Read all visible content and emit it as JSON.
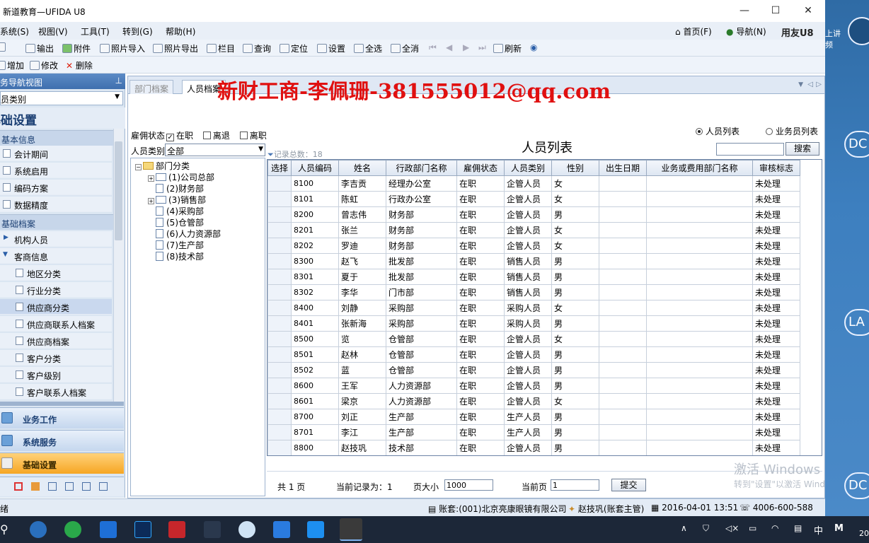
{
  "window": {
    "title": "新道教育—UFIDA U8",
    "minimize": "—",
    "maximize": "☐",
    "close": "✕"
  },
  "menubar": {
    "items": [
      "系统(S)",
      "视图(V)",
      "工具(T)",
      "转到(G)",
      "帮助(H)"
    ],
    "home": "首页(F)",
    "nav": "导航(N)",
    "brand": "用友U8"
  },
  "toolbar": {
    "items": [
      "输出",
      "附件",
      "照片导入",
      "照片导出",
      "栏目",
      "查询",
      "定位",
      "设置",
      "全选",
      "全消",
      "刷新"
    ]
  },
  "toolbar2": {
    "items": [
      "增加",
      "修改",
      "删除"
    ]
  },
  "sidebar": {
    "header": "业务导航视图",
    "select_value": "人员类别",
    "title": "基础设置",
    "group1": "基本信息",
    "group1_items": [
      "会计期间",
      "系统启用",
      "编码方案",
      "数据精度"
    ],
    "group2": "基础档案",
    "sub1": "机构人员",
    "sub2": "客商信息",
    "sub2_items": [
      "地区分类",
      "行业分类",
      "供应商分类",
      "供应商联系人档案",
      "供应商档案",
      "客户分类",
      "客户级别",
      "客户联系人档案"
    ],
    "modules": [
      "业务工作",
      "系统服务",
      "基础设置"
    ]
  },
  "tabs": [
    "部门档案",
    "人员档案"
  ],
  "overlay_text": "新财工商-李佩珊-381555012@qq.com",
  "filters": {
    "employ_label": "雇佣状态",
    "opt_active": "在职",
    "opt_left": "离退",
    "opt_resigned": "离职",
    "category_label": "人员类别",
    "category_value": "全部",
    "record_total": "记录总数：18",
    "list_title": "人员列表",
    "radio_person": "人员列表",
    "radio_sales": "业务员列表",
    "search_btn": "搜索"
  },
  "tree": {
    "root": "部门分类",
    "nodes": [
      "(1)公司总部",
      "(2)财务部",
      "(3)销售部",
      "(4)采购部",
      "(5)仓管部",
      "(6)人力资源部",
      "(7)生产部",
      "(8)技术部"
    ]
  },
  "table": {
    "columns": [
      "选择",
      "人员编码",
      "姓名",
      "行政部门名称",
      "雇佣状态",
      "人员类别",
      "性别",
      "出生日期",
      "业务或费用部门名称",
      "审核标志"
    ],
    "rows": [
      [
        "",
        "8100",
        "李吉贡",
        "经理办公室",
        "在职",
        "企管人员",
        "女",
        "",
        "",
        "未处理"
      ],
      [
        "",
        "8101",
        "陈虹",
        "行政办公室",
        "在职",
        "企管人员",
        "女",
        "",
        "",
        "未处理"
      ],
      [
        "",
        "8200",
        "曾志伟",
        "财务部",
        "在职",
        "企管人员",
        "男",
        "",
        "",
        "未处理"
      ],
      [
        "",
        "8201",
        "张兰",
        "财务部",
        "在职",
        "企管人员",
        "女",
        "",
        "",
        "未处理"
      ],
      [
        "",
        "8202",
        "罗迪",
        "财务部",
        "在职",
        "企管人员",
        "女",
        "",
        "",
        "未处理"
      ],
      [
        "",
        "8300",
        "赵飞",
        "批发部",
        "在职",
        "销售人员",
        "男",
        "",
        "",
        "未处理"
      ],
      [
        "",
        "8301",
        "夏于",
        "批发部",
        "在职",
        "销售人员",
        "男",
        "",
        "",
        "未处理"
      ],
      [
        "",
        "8302",
        "李华",
        "门市部",
        "在职",
        "销售人员",
        "男",
        "",
        "",
        "未处理"
      ],
      [
        "",
        "8400",
        "刘静",
        "采购部",
        "在职",
        "采购人员",
        "女",
        "",
        "",
        "未处理"
      ],
      [
        "",
        "8401",
        "张新海",
        "采购部",
        "在职",
        "采购人员",
        "男",
        "",
        "",
        "未处理"
      ],
      [
        "",
        "8500",
        "览",
        "仓管部",
        "在职",
        "企管人员",
        "女",
        "",
        "",
        "未处理"
      ],
      [
        "",
        "8501",
        "赵林",
        "仓管部",
        "在职",
        "企管人员",
        "男",
        "",
        "",
        "未处理"
      ],
      [
        "",
        "8502",
        "蓝",
        "仓管部",
        "在职",
        "企管人员",
        "男",
        "",
        "",
        "未处理"
      ],
      [
        "",
        "8600",
        "王军",
        "人力资源部",
        "在职",
        "企管人员",
        "男",
        "",
        "",
        "未处理"
      ],
      [
        "",
        "8601",
        "梁京",
        "人力资源部",
        "在职",
        "企管人员",
        "女",
        "",
        "",
        "未处理"
      ],
      [
        "",
        "8700",
        "刘正",
        "生产部",
        "在职",
        "生产人员",
        "男",
        "",
        "",
        "未处理"
      ],
      [
        "",
        "8701",
        "李江",
        "生产部",
        "在职",
        "生产人员",
        "男",
        "",
        "",
        "未处理"
      ],
      [
        "",
        "8800",
        "赵技巩",
        "技术部",
        "在职",
        "企管人员",
        "男",
        "",
        "",
        "未处理"
      ]
    ]
  },
  "pager": {
    "total_pages": "共 1 页",
    "current_record": "当前记录为：1",
    "page_size_label": "页大小",
    "page_size": "1000",
    "current_page_label": "当前页",
    "current_page": "1",
    "submit": "提交"
  },
  "status": {
    "left": "绪",
    "account": "账套:(001)北京亮康眼镜有限公司",
    "user": "赵技巩(账套主管)",
    "datetime": "2016-04-01 13:51",
    "phone": "4006-600-588"
  },
  "activation": {
    "line1": "激活 Windows",
    "line2": "转到\"设置\"以激活 Wind"
  },
  "right_panel": {
    "top_text": "上讲\n频",
    "circle_labels": [
      "DC",
      "LA",
      "DC"
    ]
  },
  "taskbar": {
    "lang": "中",
    "ime": "M",
    "year_frag": "20"
  }
}
